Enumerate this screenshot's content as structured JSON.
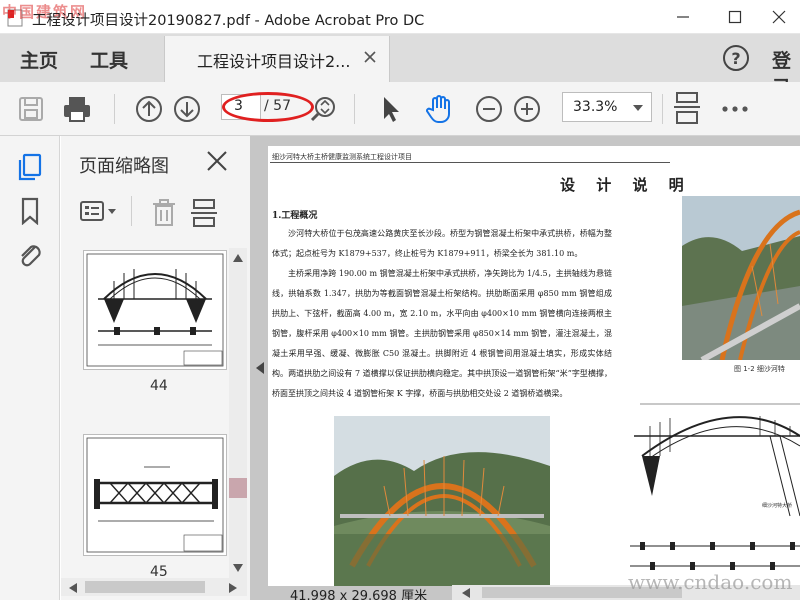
{
  "window": {
    "title": "工程设计项目设计20190827.pdf - Adobe Acrobat Pro DC",
    "watermark_top": "中国建筑网"
  },
  "tabs": {
    "home": "主页",
    "tools": "工具",
    "document": "工程设计项目设计2...",
    "signin": "登录"
  },
  "toolbar": {
    "current_page": "3",
    "total_pages": "/ 57",
    "zoom": "33.3%"
  },
  "thumbnails_panel": {
    "title": "页面缩略图",
    "pages": [
      {
        "label": "44"
      },
      {
        "label": "45"
      }
    ]
  },
  "document": {
    "header": "细沙河特大桥主桥健康监测系统工程设计项目",
    "title": "设 计 说 明",
    "section_title": "1.工程概况",
    "paragraphs": [
      "沙河特大桥位于包茂高速公路黄庆至长沙段。桥型为钢管混凝土桁架中承式拱桥，桥幅为整体式；起点桩号为 K1879+537，终止桩号为 K1879+911，桥梁全长为 381.10 m。",
      "主桥采用净跨 190.00 m 钢管混凝土桁架中承式拱桥，净矢跨比为 1/4.5，主拱轴线为悬链线，拱轴系数 1.347，拱肋为等截面钢管混凝土桁架结构。拱肋断面采用 φ850 mm 钢管组成拱肋上、下弦杆，截面高 4.00 m，宽 2.10 m，水平向由 φ400×10 mm 钢管横向连接两根主钢管，腹杆采用 φ400×10 mm 钢管。主拱肋钢管采用 φ850×14 mm 钢管，灌注混凝土，混凝土采用早强、缓凝、微膨胀 C50 混凝土。拱脚附近 4 根钢管间用混凝土填实，形成实体结构。两道拱肋之间设有 7 道横撑以保证拱肋横向稳定。其中拱顶设一道钢管桁架“米”字型横撑，桥面至拱顶之间共设 4 道钢管桁架 K 字撑，桥面与拱肋相交处设 2 道钢桥道横梁。"
    ],
    "photo_caption": "图 1-2  细沙河特",
    "drawing_label": "细沙河特大桥"
  },
  "status": {
    "page_dimensions": "41.998 x 29.698 厘米",
    "watermark_bottom": "www.cndao.com"
  },
  "colors": {
    "annotation_red": "#e02020",
    "hand_tool_blue": "#1473e6",
    "arch_orange": "#d9731c"
  }
}
